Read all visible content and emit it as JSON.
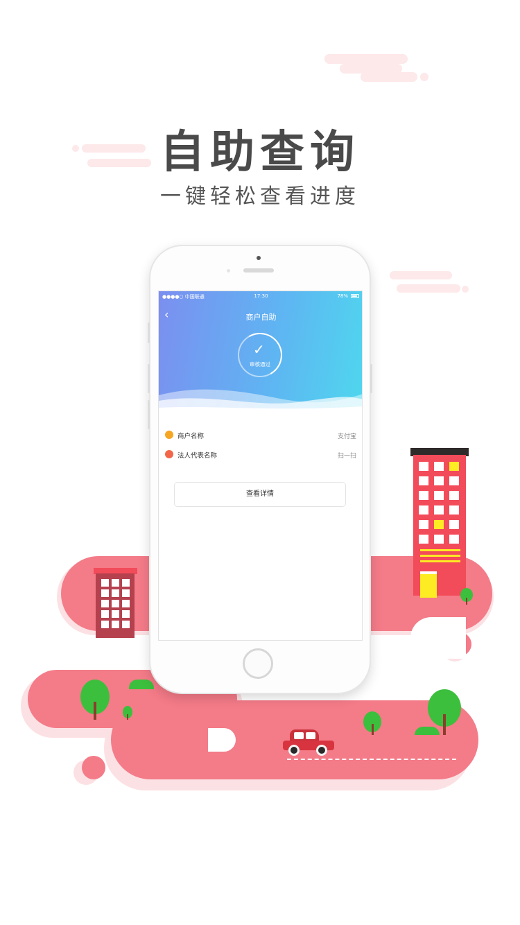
{
  "header": {
    "title": "自助查询",
    "subtitle": "一键轻松查看进度"
  },
  "phone_screen": {
    "status_bar": {
      "carrier": "●●●●○ 中国联通",
      "time": "17:30",
      "battery": "78%"
    },
    "nav": {
      "back_icon": "chevron-left-icon",
      "title": "商户自助"
    },
    "status_badge": {
      "icon": "check-icon",
      "label": "审核通过"
    },
    "rows": [
      {
        "label": "商户名称",
        "value": "支付宝",
        "icon": "merchant-icon",
        "icon_color": "#f5a623"
      },
      {
        "label": "法人代表名称",
        "value": "扫一扫",
        "icon": "person-icon",
        "icon_color": "#f2674a"
      }
    ],
    "detail_button": "查看详情"
  },
  "colors": {
    "accent_pink": "#f47b88",
    "building_red": "#f24b5a",
    "header_gradient_start": "#7b8ff0",
    "header_gradient_end": "#4fd7ee"
  }
}
